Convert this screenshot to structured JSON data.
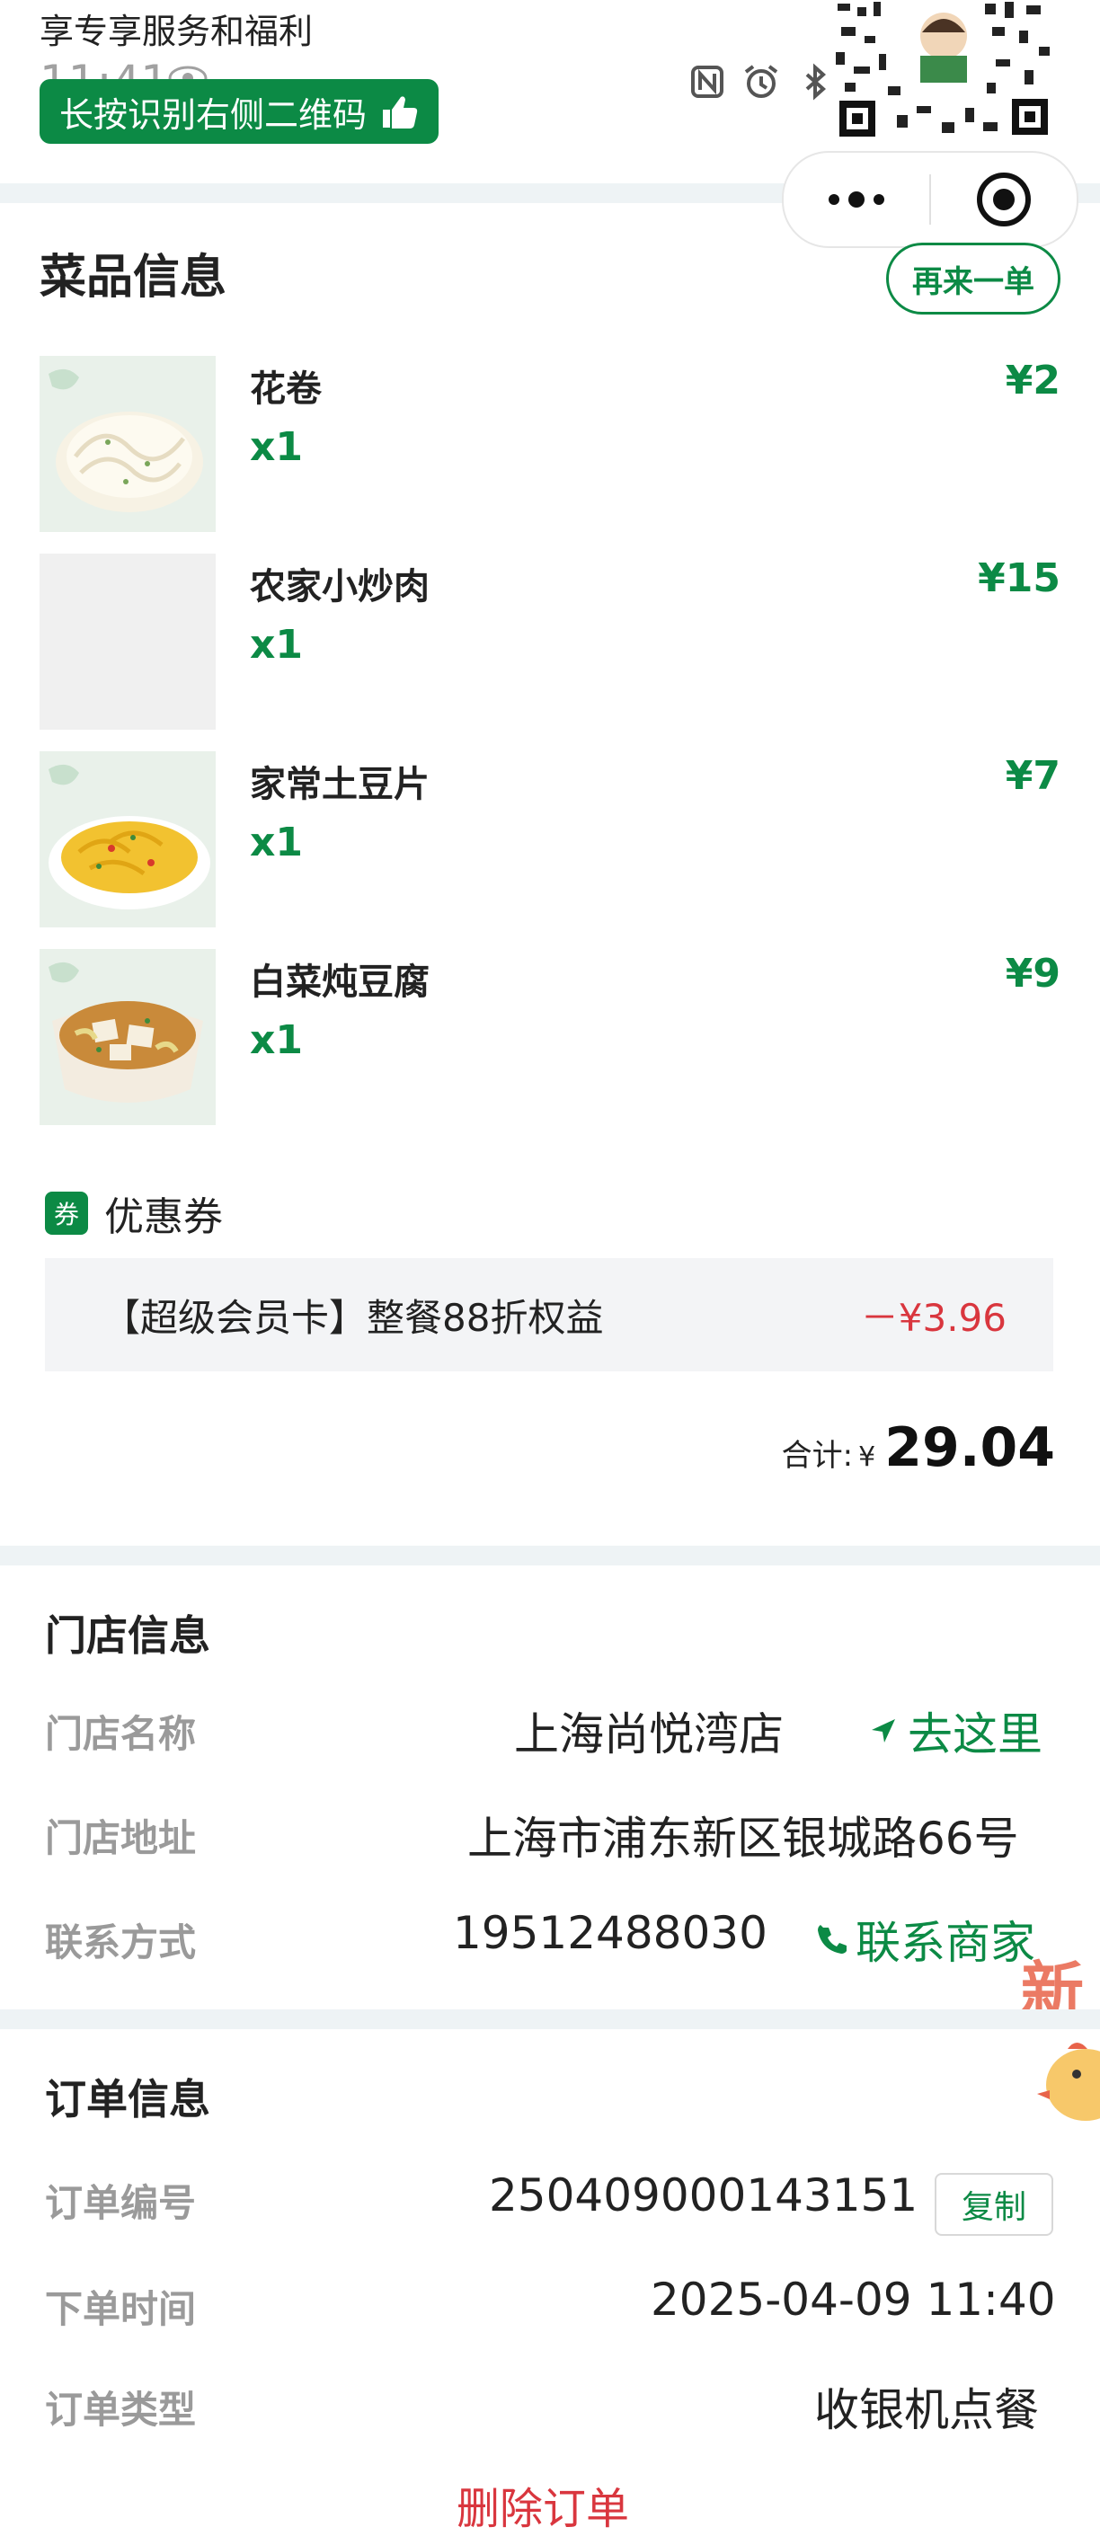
{
  "banner": {
    "title": "享专享服务和福利",
    "long_press": "长按识别右侧二维码",
    "clock": "11:41"
  },
  "dishes_section": {
    "title": "菜品信息",
    "reorder_label": "再来一单",
    "items": [
      {
        "name": "花卷",
        "qty": "x1",
        "price": "¥2"
      },
      {
        "name": "农家小炒肉",
        "qty": "x1",
        "price": "¥15"
      },
      {
        "name": "家常土豆片",
        "qty": "x1",
        "price": "¥7"
      },
      {
        "name": "白菜炖豆腐",
        "qty": "x1",
        "price": "¥9"
      }
    ]
  },
  "coupon": {
    "badge": "券",
    "title": "优惠券",
    "name": "【超级会员卡】整餐88折权益",
    "discount": "－¥3.96"
  },
  "total": {
    "label": "合计:",
    "currency": "¥",
    "amount": "29.04"
  },
  "store": {
    "title": "门店信息",
    "name_label": "门店名称",
    "name": "上海尚悦湾店",
    "navigate": "去这里",
    "address_label": "门店地址",
    "address": "上海市浦东新区银城路66号",
    "contact_label": "联系方式",
    "phone": "19512488030",
    "contact_merchant": "联系商家"
  },
  "order": {
    "title": "订单信息",
    "number_label": "订单编号",
    "number": "250409000143151",
    "copy": "复制",
    "time_label": "下单时间",
    "time": "2025-04-09 11:40",
    "type_label": "订单类型",
    "type": "收银机点餐",
    "delete": "删除订单"
  },
  "colors": {
    "brand_green": "#0c8a45",
    "discount_red": "#d9363e",
    "divider": "#eef3f5"
  }
}
